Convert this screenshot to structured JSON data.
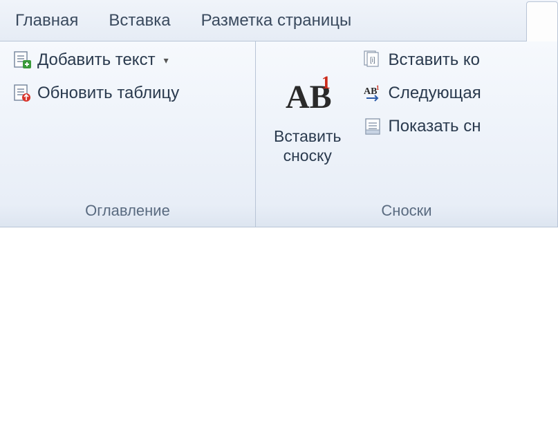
{
  "tabs": {
    "home": "Главная",
    "insert": "Вставка",
    "layout": "Разметка страницы"
  },
  "groups": {
    "toc": {
      "addText": "Добавить текст",
      "updateTable": "Обновить таблицу",
      "label": "Оглавление"
    },
    "footnotes": {
      "insertFootnote": "Вставить\nсноску",
      "insertEndnote": "Вставить ко",
      "nextFootnote": "Следующая",
      "showNotes": "Показать сн",
      "label": "Сноски"
    }
  }
}
